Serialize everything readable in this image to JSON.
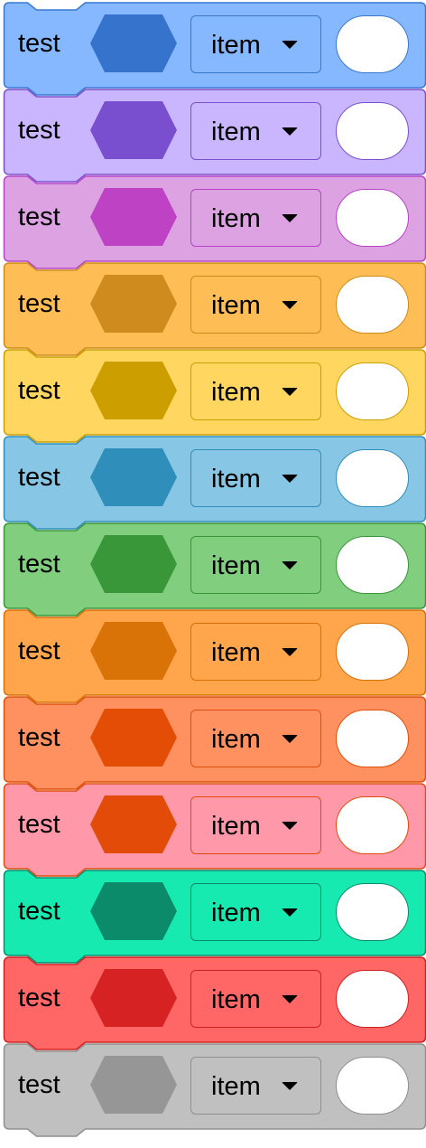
{
  "blocks": [
    {
      "label": "test",
      "dropdown_value": "item",
      "fill": "#85b8ff",
      "border": "#3a78d0",
      "hex": "#3573cc"
    },
    {
      "label": "test",
      "dropdown_value": "item",
      "fill": "#c9b6ff",
      "border": "#7a4fcf",
      "hex": "#7a4fcf"
    },
    {
      "label": "test",
      "dropdown_value": "item",
      "fill": "#dca2e2",
      "border": "#b743c6",
      "hex": "#be43c4"
    },
    {
      "label": "test",
      "dropdown_value": "item",
      "fill": "#ffbd55",
      "border": "#cf8b17",
      "hex": "#d08b1e"
    },
    {
      "label": "test",
      "dropdown_value": "item",
      "fill": "#ffd760",
      "border": "#cc9e00",
      "hex": "#cc9e00"
    },
    {
      "label": "test",
      "dropdown_value": "item",
      "fill": "#87c6e4",
      "border": "#2f8fba",
      "hex": "#2f8fba"
    },
    {
      "label": "test",
      "dropdown_value": "item",
      "fill": "#80ce7e",
      "border": "#399639",
      "hex": "#399639"
    },
    {
      "label": "test",
      "dropdown_value": "item",
      "fill": "#ffa54b",
      "border": "#d87006",
      "hex": "#d97207"
    },
    {
      "label": "test",
      "dropdown_value": "item",
      "fill": "#ff9161",
      "border": "#e0500a",
      "hex": "#e34d05"
    },
    {
      "label": "test",
      "dropdown_value": "item",
      "fill": "#ff99aa",
      "border": "#e14d0c",
      "hex": "#e24c08"
    },
    {
      "label": "test",
      "dropdown_value": "item",
      "fill": "#17eab0",
      "border": "#0c8a6a",
      "hex": "#0c8b6b"
    },
    {
      "label": "test",
      "dropdown_value": "item",
      "fill": "#ff6666",
      "border": "#d12020",
      "hex": "#d62222"
    },
    {
      "label": "test",
      "dropdown_value": "item",
      "fill": "#c0c0c0",
      "border": "#8f8f8f",
      "hex": "#969696"
    }
  ]
}
